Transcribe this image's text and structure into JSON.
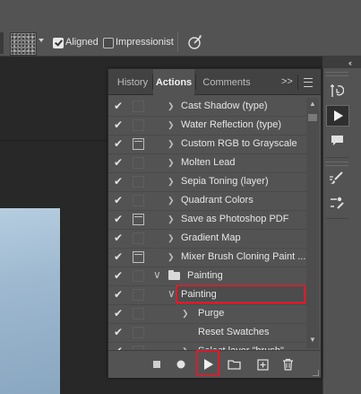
{
  "options_bar": {
    "aligned_label": "Aligned",
    "aligned_checked": true,
    "impressionist_label": "Impressionist",
    "impressionist_checked": false
  },
  "panel": {
    "tabs": [
      {
        "label": "History",
        "active": false
      },
      {
        "label": "Actions",
        "active": true
      },
      {
        "label": "Comments",
        "active": false
      }
    ],
    "expand_label": ">>",
    "actions": [
      {
        "checked": true,
        "dialog": false,
        "label": "Cast Shadow (type)",
        "arrow": "right",
        "indent": 1
      },
      {
        "checked": true,
        "dialog": false,
        "label": "Water Reflection (type)",
        "arrow": "right",
        "indent": 1
      },
      {
        "checked": true,
        "dialog": true,
        "label": "Custom RGB to Grayscale",
        "arrow": "right",
        "indent": 1
      },
      {
        "checked": true,
        "dialog": false,
        "label": "Molten Lead",
        "arrow": "right",
        "indent": 1
      },
      {
        "checked": true,
        "dialog": false,
        "label": "Sepia Toning (layer)",
        "arrow": "right",
        "indent": 1
      },
      {
        "checked": true,
        "dialog": false,
        "label": "Quadrant Colors",
        "arrow": "right",
        "indent": 1
      },
      {
        "checked": true,
        "dialog": true,
        "label": "Save as Photoshop PDF",
        "arrow": "right",
        "indent": 1
      },
      {
        "checked": true,
        "dialog": false,
        "label": "Gradient Map",
        "arrow": "right",
        "indent": 1
      },
      {
        "checked": true,
        "dialog": true,
        "label": "Mixer Brush Cloning Paint ...",
        "arrow": "right",
        "indent": 1
      },
      {
        "checked": true,
        "dialog": false,
        "label": "Painting",
        "arrow": "down",
        "indent": 0,
        "folder": true
      },
      {
        "checked": true,
        "dialog": false,
        "label": "Painting",
        "arrow": "down",
        "indent": 1,
        "highlighted": true
      },
      {
        "checked": true,
        "dialog": false,
        "label": "Purge",
        "arrow": "right",
        "indent": 2
      },
      {
        "checked": true,
        "dialog": false,
        "label": "Reset Swatches",
        "arrow": "none",
        "indent": 2
      },
      {
        "checked": true,
        "dialog": false,
        "label": "Select layer \"brush\"",
        "arrow": "right",
        "indent": 2
      }
    ]
  },
  "icons": {
    "stop": "stop-icon",
    "record": "record-icon",
    "play": "play-icon",
    "new_set": "folder-icon",
    "new_action": "new-action-icon",
    "delete": "trash-icon"
  },
  "colors": {
    "highlight_box": "#d2202e",
    "panel_bg": "#535353"
  }
}
